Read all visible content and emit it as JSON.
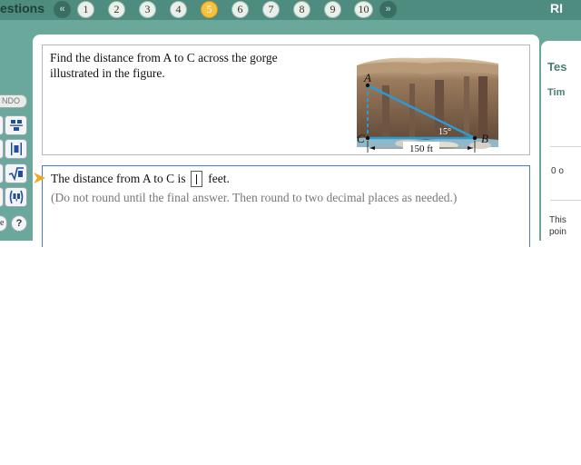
{
  "nav": {
    "brand_text": "estions",
    "prev_label": "«",
    "next_label": "»",
    "questions": [
      "1",
      "2",
      "3",
      "4",
      "5",
      "6",
      "7",
      "8",
      "9",
      "10"
    ],
    "current_question": "5",
    "right_label": "RI"
  },
  "toolbar": {
    "undo_label": "NDO",
    "tools": [
      "fraction-icon",
      "absolute-value-icon",
      "square-root-icon",
      "ordered-pair-icon"
    ],
    "more_label": "e",
    "help_label": "?"
  },
  "question": {
    "prompt": "Find the distance from A to C across the gorge illustrated in the figure.",
    "figure": {
      "label_a": "A",
      "label_b": "B",
      "label_c": "C",
      "angle_label": "15°",
      "distance_label": "150 ft"
    }
  },
  "answer": {
    "prefix": "The distance from A to C is",
    "suffix": "feet.",
    "instruction": "(Do not round until the final answer. Then round to two decimal places as needed.)"
  },
  "sidebar": {
    "test_label": "Tes",
    "time_label": "Tim",
    "count_label": "0 o",
    "note_line1": "This",
    "note_line2": "poin"
  },
  "colors": {
    "teal_band": "#6aa89b",
    "nav_bar": "#4e8c7f",
    "current_question": "#f7c242",
    "answer_border": "#4a7fb8",
    "figure_line": "#2b9bd6"
  }
}
